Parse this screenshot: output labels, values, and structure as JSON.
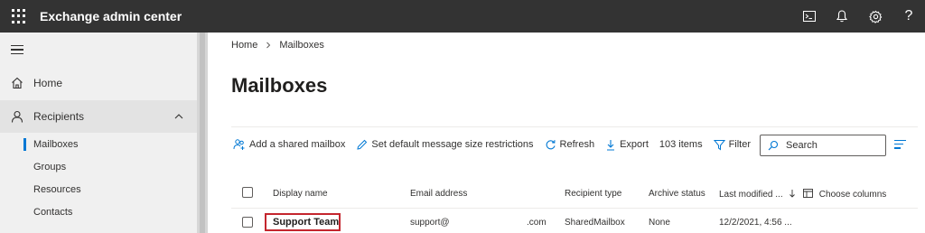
{
  "app": {
    "title": "Exchange admin center"
  },
  "topbar_icons": [
    "cloud-shell-icon",
    "bell-icon",
    "gear-icon",
    "help-icon"
  ],
  "topbar": {
    "help_glyph": "?"
  },
  "sidebar": {
    "items": [
      {
        "label": "Home",
        "icon": "home-icon"
      },
      {
        "label": "Recipients",
        "icon": "person-icon",
        "expanded": true
      }
    ],
    "sub_items": [
      {
        "label": "Mailboxes",
        "active": true
      },
      {
        "label": "Groups"
      },
      {
        "label": "Resources"
      },
      {
        "label": "Contacts"
      }
    ]
  },
  "breadcrumb": {
    "home": "Home",
    "current": "Mailboxes"
  },
  "page": {
    "title": "Mailboxes"
  },
  "commands": {
    "add_shared": "Add a shared mailbox",
    "set_size": "Set default message size restrictions",
    "refresh": "Refresh",
    "export": "Export",
    "count": "103 items",
    "filter": "Filter"
  },
  "search": {
    "placeholder": "Search"
  },
  "table": {
    "headers": {
      "display_name": "Display name",
      "email": "Email address",
      "recipient_type": "Recipient type",
      "archive_status": "Archive status",
      "last_modified": "Last modified ...",
      "choose_columns": "Choose columns"
    },
    "rows": [
      {
        "display_name": "Support Team",
        "email_local": "support@",
        "email_domain": ".com",
        "recipient_type": "SharedMailbox",
        "archive_status": "None",
        "last_modified": "12/2/2021, 4:56 ..."
      }
    ]
  },
  "colors": {
    "accent": "#0078d4",
    "highlight": "#c4262e",
    "topbar": "#333333"
  }
}
